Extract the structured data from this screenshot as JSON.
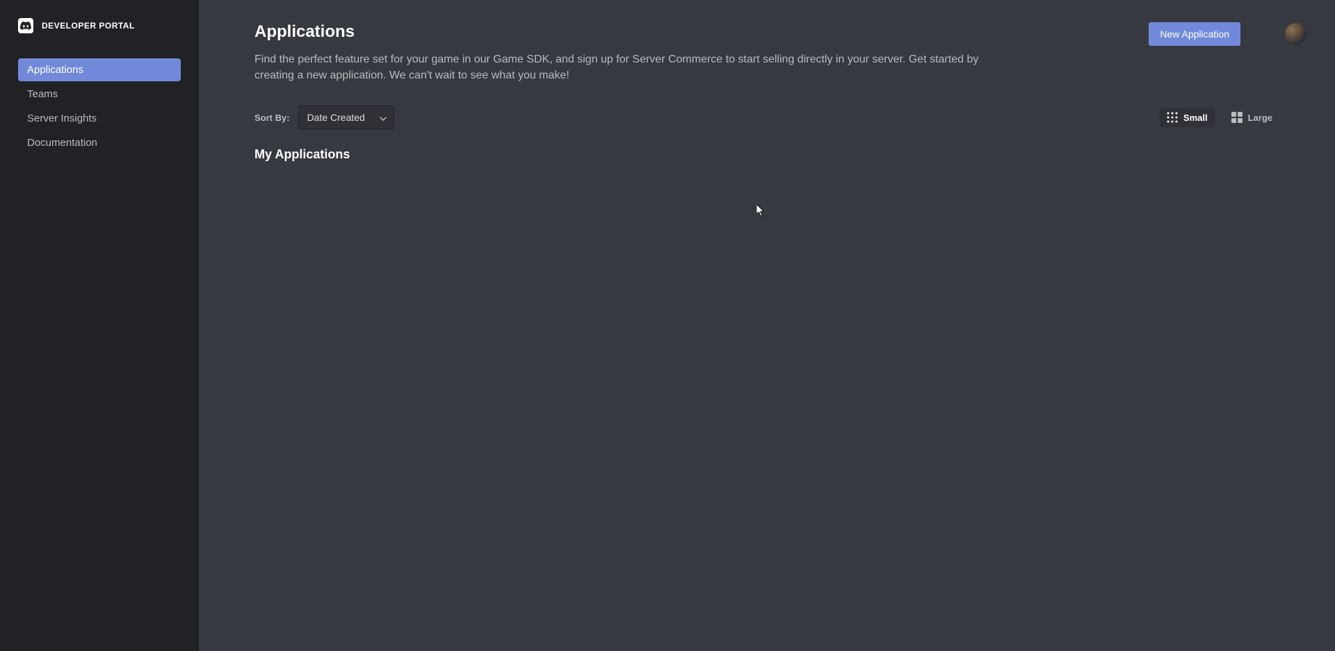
{
  "brand": {
    "title": "DEVELOPER PORTAL"
  },
  "sidebar": {
    "items": [
      {
        "label": "Applications",
        "active": true
      },
      {
        "label": "Teams",
        "active": false
      },
      {
        "label": "Server Insights",
        "active": false
      },
      {
        "label": "Documentation",
        "active": false
      }
    ]
  },
  "header": {
    "title": "Applications",
    "new_app_label": "New Application"
  },
  "description": "Find the perfect feature set for your game in our Game SDK, and sign up for Server Commerce to start selling directly in your server. Get started by creating a new application. We can't wait to see what you make!",
  "sort": {
    "label": "Sort By:",
    "selected": "Date Created"
  },
  "view": {
    "small_label": "Small",
    "large_label": "Large"
  },
  "section": {
    "title": "My Applications"
  }
}
